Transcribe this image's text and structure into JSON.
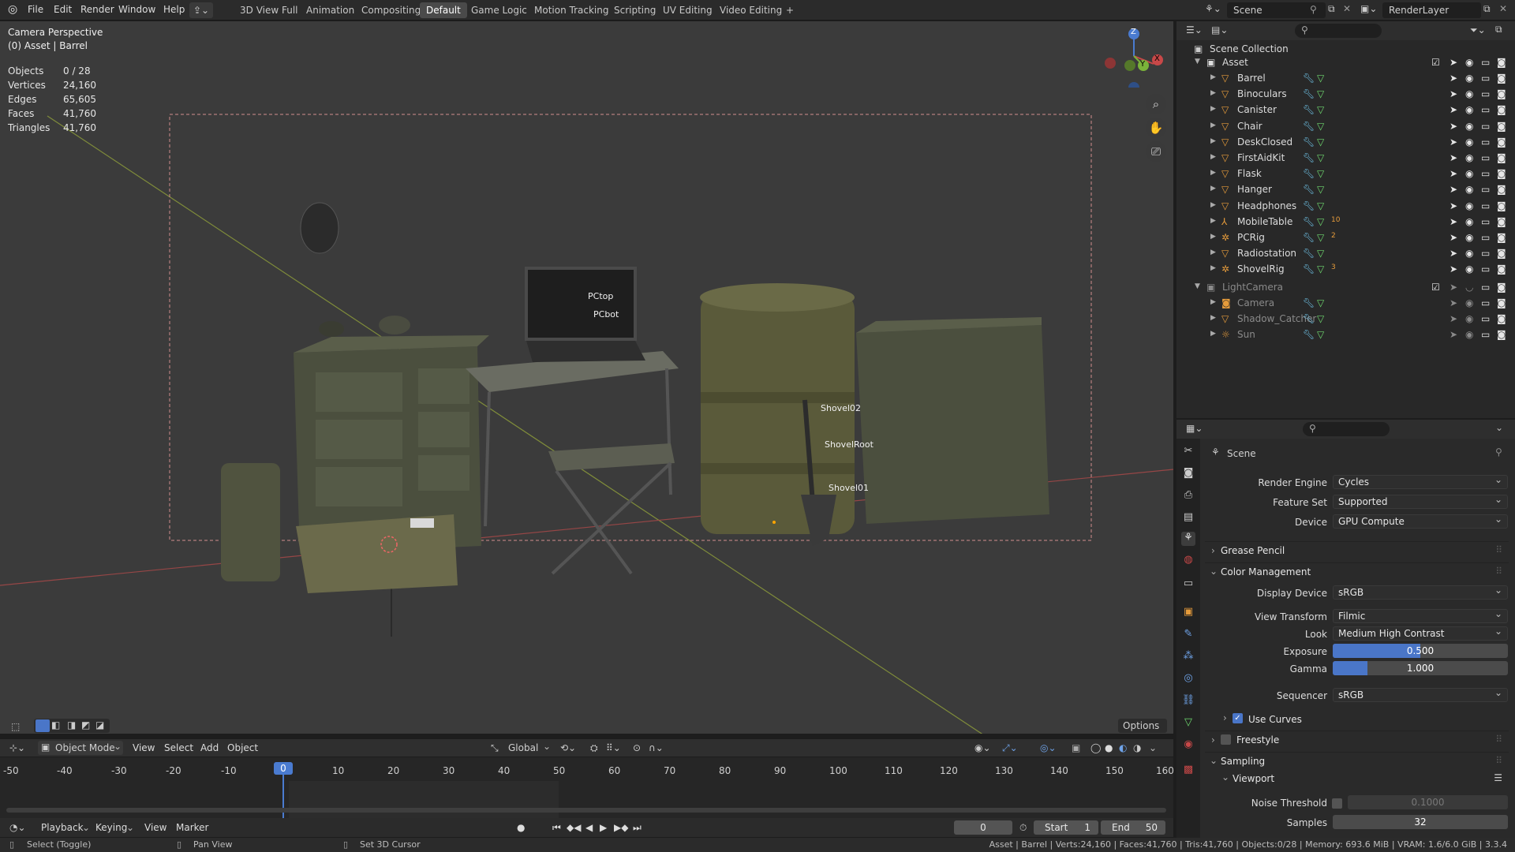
{
  "topbar": {
    "menus": [
      "File",
      "Edit",
      "Render",
      "Window",
      "Help"
    ],
    "workspaces": [
      "3D View Full",
      "Animation",
      "Compositing",
      "Default",
      "Game Logic",
      "Motion Tracking",
      "Scripting",
      "UV Editing",
      "Video Editing"
    ],
    "active_workspace": "Default",
    "add_tab": "+",
    "scene_name": "Scene",
    "view_layer": "RenderLayer"
  },
  "viewport": {
    "title": "Camera Perspective",
    "subtitle": "(0) Asset | Barrel",
    "stats": [
      {
        "label": "Objects",
        "value": "0 / 28"
      },
      {
        "label": "Vertices",
        "value": "24,160"
      },
      {
        "label": "Edges",
        "value": "65,605"
      },
      {
        "label": "Faces",
        "value": "41,760"
      },
      {
        "label": "Triangles",
        "value": "41,760"
      }
    ],
    "gizmo": {
      "z": "Z",
      "y": "Y",
      "x": "X"
    },
    "object_labels": [
      "PCtop",
      "PCbot",
      "Shovel02",
      "ShovelRoot",
      "Shovel01"
    ],
    "options_label": "Options"
  },
  "viewport_header": {
    "mode": "Object Mode",
    "menus": [
      "View",
      "Select",
      "Add",
      "Object"
    ],
    "orientation": "Global"
  },
  "timeline": {
    "ticks": [
      "-50",
      "-40",
      "-30",
      "-20",
      "-10",
      "0",
      "10",
      "20",
      "30",
      "40",
      "50",
      "60",
      "70",
      "80",
      "90",
      "100",
      "110",
      "120",
      "130",
      "140",
      "150",
      "160"
    ],
    "current_frame": "0",
    "menus": [
      "Playback",
      "Keying",
      "View",
      "Marker"
    ],
    "frame_field": "0",
    "start_label": "Start",
    "start": "1",
    "end_label": "End",
    "end": "50"
  },
  "outliner": {
    "root": "Scene Collection",
    "collections": [
      {
        "name": "Asset",
        "items": [
          {
            "name": "Barrel",
            "kind": "mesh",
            "badge": ""
          },
          {
            "name": "Binoculars",
            "kind": "mesh",
            "badge": ""
          },
          {
            "name": "Canister",
            "kind": "mesh",
            "badge": ""
          },
          {
            "name": "Chair",
            "kind": "mesh",
            "badge": ""
          },
          {
            "name": "DeskClosed",
            "kind": "mesh",
            "badge": ""
          },
          {
            "name": "FirstAidKit",
            "kind": "mesh",
            "badge": ""
          },
          {
            "name": "Flask",
            "kind": "mesh",
            "badge": ""
          },
          {
            "name": "Hanger",
            "kind": "mesh",
            "badge": ""
          },
          {
            "name": "Headphones",
            "kind": "mesh",
            "badge": ""
          },
          {
            "name": "MobileTable",
            "kind": "empty",
            "badge": "10"
          },
          {
            "name": "PCRig",
            "kind": "armature",
            "badge": "2"
          },
          {
            "name": "Radiostation",
            "kind": "mesh",
            "badge": ""
          },
          {
            "name": "ShovelRig",
            "kind": "armature",
            "badge": "3"
          }
        ]
      },
      {
        "name": "LightCamera",
        "items": [
          {
            "name": "Camera",
            "kind": "camera",
            "badge": ""
          },
          {
            "name": "Shadow_Catcher",
            "kind": "mesh",
            "badge": ""
          },
          {
            "name": "Sun",
            "kind": "light",
            "badge": ""
          }
        ]
      }
    ]
  },
  "properties": {
    "context": "Scene",
    "render_engine_label": "Render Engine",
    "render_engine": "Cycles",
    "feature_set_label": "Feature Set",
    "feature_set": "Supported",
    "device_label": "Device",
    "device": "GPU Compute",
    "grease_pencil": "Grease Pencil",
    "color_management": "Color Management",
    "display_device_label": "Display Device",
    "display_device": "sRGB",
    "view_transform_label": "View Transform",
    "view_transform": "Filmic",
    "look_label": "Look",
    "look": "Medium High Contrast",
    "exposure_label": "Exposure",
    "exposure": "0.500",
    "exposure_fill": 0.5,
    "gamma_label": "Gamma",
    "gamma": "1.000",
    "gamma_fill": 0.2,
    "sequencer_label": "Sequencer",
    "sequencer": "sRGB",
    "use_curves": "Use Curves",
    "freestyle": "Freestyle",
    "sampling": "Sampling",
    "viewport": "Viewport",
    "noise_threshold_label": "Noise Threshold",
    "noise_threshold": "0.1000",
    "samples_label": "Samples",
    "samples": "32"
  },
  "statusbar": {
    "select": "Select (Toggle)",
    "pan": "Pan View",
    "cursor": "Set 3D Cursor",
    "info": "Asset | Barrel | Verts:24,160 | Faces:41,760 | Tris:41,760 | Objects:0/28 | Memory: 693.6 MiB | VRAM: 1.6/6.0 GiB | 3.3.4"
  },
  "colors": {
    "accent": "#4a76c8",
    "mesh_orange": "#e59b3b",
    "modifier_blue": "#6fc3e8",
    "data_green": "#6fd96f"
  }
}
